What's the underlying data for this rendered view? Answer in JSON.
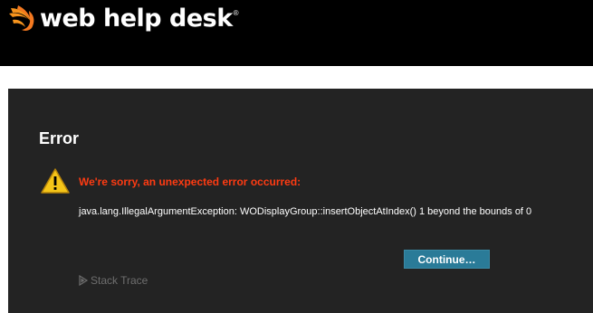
{
  "header": {
    "logo_text": "web help desk",
    "logo_reg": "®",
    "logo_icon": "solarwinds-flame-icon",
    "background": "#000000"
  },
  "error_panel": {
    "title": "Error",
    "warning_icon": "warning-triangle-icon",
    "heading": "We're sorry, an unexpected error occurred:",
    "message": "java.lang.IllegalArgumentException: WODisplayGroup::insertObjectAtIndex() 1 beyond the bounds of 0",
    "continue_label": "Continue…",
    "stack_trace_label": "Stack Trace",
    "stack_trace_icon": "disclosure-triangle-icon",
    "colors": {
      "panel_background": "#232323",
      "heading": "#ff3b12",
      "button": "#2a7b98"
    }
  }
}
